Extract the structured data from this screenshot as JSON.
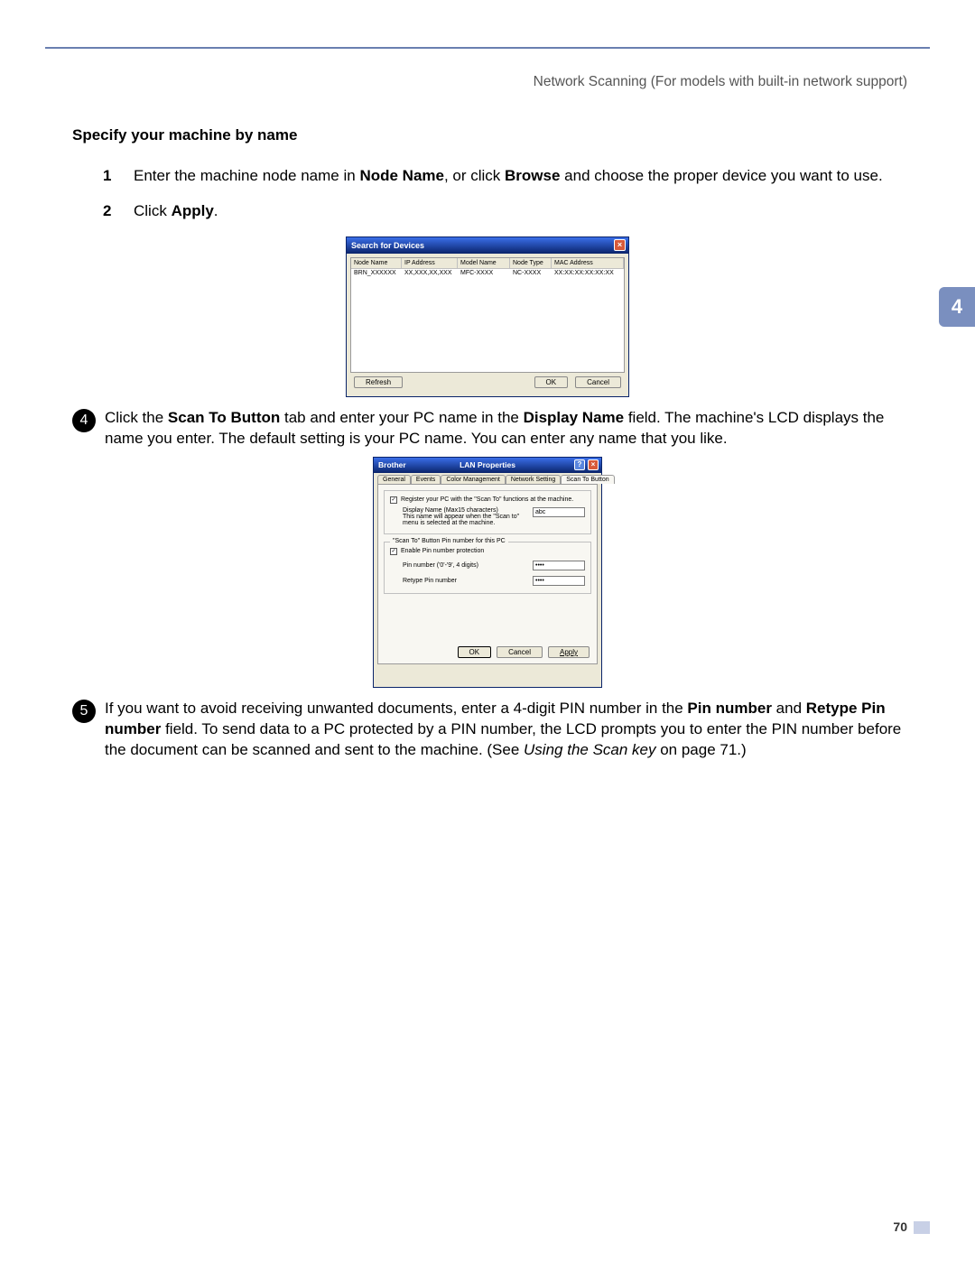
{
  "header": {
    "running_title": "Network Scanning (For models with built-in network support)"
  },
  "side_tab": "4",
  "page_number": "70",
  "section": {
    "title": "Specify your machine by name"
  },
  "numlist": [
    {
      "num": "1",
      "text_pre": "Enter the machine node name in ",
      "bold1": "Node Name",
      "text_mid": ", or click ",
      "bold2": "Browse",
      "text_post": " and choose the proper device you want to use."
    },
    {
      "num": "2",
      "text_pre": "Click ",
      "bold1": "Apply",
      "text_post": "."
    }
  ],
  "dialog1": {
    "title": "Search for Devices",
    "columns": [
      "Node Name",
      "IP Address",
      "Model Name",
      "Node Type",
      "MAC Address"
    ],
    "rows": [
      [
        "BRN_XXXXXX",
        "XX,XXX,XX,XXX",
        "MFC-XXXX",
        "NC-XXXX",
        "XX:XX:XX:XX:XX:XX"
      ]
    ],
    "btn_refresh": "Refresh",
    "btn_ok": "OK",
    "btn_cancel": "Cancel"
  },
  "step4": {
    "bullet": "4",
    "p1": "Click the ",
    "b1": "Scan To Button",
    "p2": " tab and enter your PC name in the ",
    "b2": "Display Name",
    "p3": " field. The machine's LCD displays the name you enter. The default setting is your PC name. You can enter any name that you like."
  },
  "dialog2": {
    "title_left": "Brother",
    "title_center": "LAN Properties",
    "tabs": [
      "General",
      "Events",
      "Color Management",
      "Network Setting",
      "Scan To Button"
    ],
    "active_tab": 4,
    "group1_check": "Register your PC with the \"Scan To\" functions at the machine.",
    "group1_label": "Display Name (Max15 characters)\nThis name will appear when the \"Scan to\" menu is selected at the machine.",
    "group1_value": "abc",
    "group2_legend": "\"Scan To\" Button Pin number for this PC",
    "group2_check": "Enable Pin number protection",
    "pin_label": "Pin number ('0'-'9', 4 digits)",
    "pin_value": "••••",
    "repin_label": "Retype Pin number",
    "repin_value": "••••",
    "btn_ok": "OK",
    "btn_cancel": "Cancel",
    "btn_apply": "Apply"
  },
  "step5": {
    "bullet": "5",
    "p1": "If you want to avoid receiving unwanted documents, enter a 4-digit PIN number in the ",
    "b1": "Pin number",
    "p2": " and ",
    "b2": "Retype Pin number",
    "p3": " field. To send data to a PC protected by a PIN number, the LCD prompts you to enter the PIN number before the document can be scanned and sent to the machine. (See ",
    "i1": "Using the Scan key",
    "p4": " on page 71.)"
  }
}
